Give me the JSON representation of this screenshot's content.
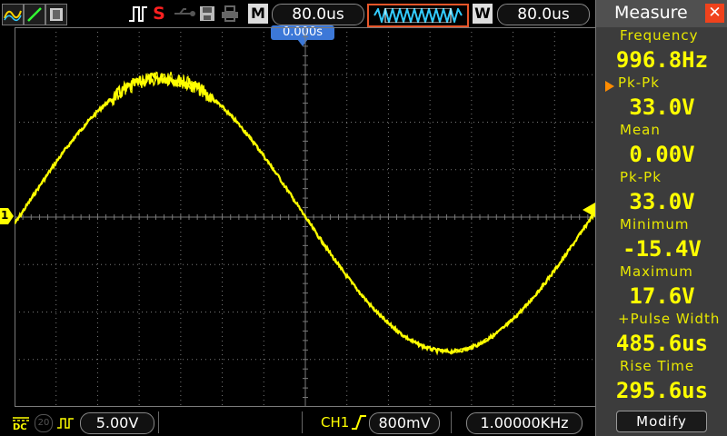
{
  "top": {
    "timebase": "80.0us",
    "window_timebase": "80.0us",
    "m_label": "M",
    "w_label": "W",
    "trigger_status": "S",
    "trigger_offset": "0.000s"
  },
  "bottom": {
    "ch1_scale": "5.00V",
    "trigger_channel": "CH1",
    "trigger_level": "800mV",
    "trigger_frequency": "1.00000KHz",
    "probe_badge": "20"
  },
  "screen": {
    "channel_marker": "1"
  },
  "panel": {
    "title": "Measure",
    "modify_label": "Modify",
    "measurements": [
      {
        "label": "Frequency",
        "value": "996.8Hz"
      },
      {
        "label": "Pk-Pk",
        "value": "33.0V"
      },
      {
        "label": "Mean",
        "value": "0.00V"
      },
      {
        "label": "Pk-Pk",
        "value": "33.0V"
      },
      {
        "label": "Minimum",
        "value": "-15.4V"
      },
      {
        "label": "Maximum",
        "value": "17.6V"
      },
      {
        "label": "+Pulse Width",
        "value": "485.6us"
      },
      {
        "label": "Rise Time",
        "value": "295.6us"
      }
    ]
  },
  "colors": {
    "trace": "#ffff00",
    "grid": "#7a7a7a",
    "panel_bg": "#3c3c3c",
    "marker_blue": "#3c78d8",
    "close_red": "#f0421c"
  }
}
